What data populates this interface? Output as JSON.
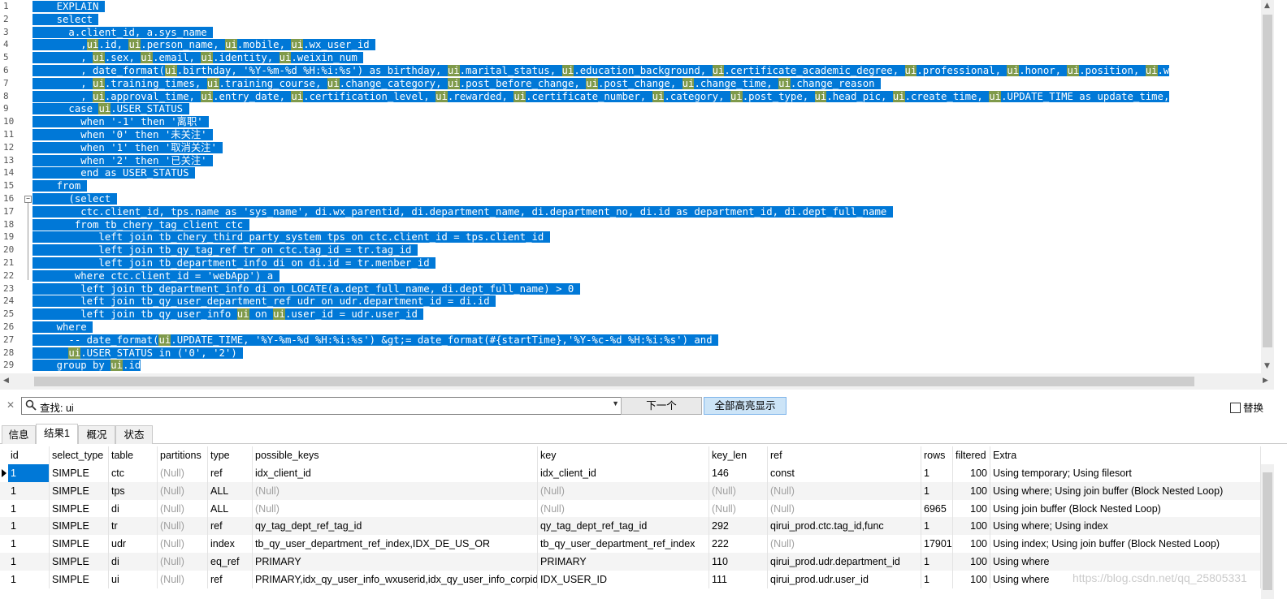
{
  "editor": {
    "line_numbers": [
      "1",
      "2",
      "3",
      "4",
      "5",
      "6",
      "7",
      "8",
      "9",
      "10",
      "11",
      "12",
      "13",
      "14",
      "15",
      "16",
      "17",
      "18",
      "19",
      "20",
      "21",
      "22",
      "23",
      "24",
      "25",
      "26",
      "27",
      "28",
      "29"
    ],
    "lines": [
      [
        [
          "",
          "    EXPLAIN "
        ]
      ],
      [
        [
          "",
          "    select "
        ]
      ],
      [
        [
          "",
          "      a.client_id, a.sys_name "
        ]
      ],
      [
        [
          "",
          "        ,"
        ],
        [
          "h",
          "ui"
        ],
        [
          "",
          ".id, "
        ],
        [
          "h",
          "ui"
        ],
        [
          "",
          ".person_name, "
        ],
        [
          "h",
          "ui"
        ],
        [
          "",
          ".mobile, "
        ],
        [
          "h",
          "ui"
        ],
        [
          "",
          ".wx_user_id "
        ]
      ],
      [
        [
          "",
          "        , "
        ],
        [
          "h",
          "ui"
        ],
        [
          "",
          ".sex, "
        ],
        [
          "h",
          "ui"
        ],
        [
          "",
          ".email, "
        ],
        [
          "h",
          "ui"
        ],
        [
          "",
          ".identity, "
        ],
        [
          "h",
          "ui"
        ],
        [
          "",
          ".weixin_num "
        ]
      ],
      [
        [
          "",
          "        , date_format("
        ],
        [
          "h",
          "ui"
        ],
        [
          "",
          ".birthday, '%Y-%m-%d %H:%i:%s') as birthday, "
        ],
        [
          "h",
          "ui"
        ],
        [
          "",
          ".marital_status, "
        ],
        [
          "h",
          "ui"
        ],
        [
          "",
          ".education_background, "
        ],
        [
          "h",
          "ui"
        ],
        [
          "",
          ".certificate_academic_degree, "
        ],
        [
          "h",
          "ui"
        ],
        [
          "",
          ".professional, "
        ],
        [
          "h",
          "ui"
        ],
        [
          "",
          ".honor, "
        ],
        [
          "h",
          "ui"
        ],
        [
          "",
          ".position, "
        ],
        [
          "h",
          "ui"
        ],
        [
          "",
          ".w"
        ]
      ],
      [
        [
          "",
          "        , "
        ],
        [
          "h",
          "ui"
        ],
        [
          "",
          ".training_times, "
        ],
        [
          "h",
          "ui"
        ],
        [
          "",
          ".training_course, "
        ],
        [
          "h",
          "ui"
        ],
        [
          "",
          ".change_category, "
        ],
        [
          "h",
          "ui"
        ],
        [
          "",
          ".post_before_change, "
        ],
        [
          "h",
          "ui"
        ],
        [
          "",
          ".post_change, "
        ],
        [
          "h",
          "ui"
        ],
        [
          "",
          ".change_time, "
        ],
        [
          "h",
          "ui"
        ],
        [
          "",
          ".change_reason "
        ]
      ],
      [
        [
          "",
          "        , "
        ],
        [
          "h",
          "ui"
        ],
        [
          "",
          ".approval_time, "
        ],
        [
          "h",
          "ui"
        ],
        [
          "",
          ".entry_date, "
        ],
        [
          "h",
          "ui"
        ],
        [
          "",
          ".certification_level, "
        ],
        [
          "h",
          "ui"
        ],
        [
          "",
          ".rewarded, "
        ],
        [
          "h",
          "ui"
        ],
        [
          "",
          ".certificate_number, "
        ],
        [
          "h",
          "ui"
        ],
        [
          "",
          ".category, "
        ],
        [
          "h",
          "ui"
        ],
        [
          "",
          ".post_type, "
        ],
        [
          "h",
          "ui"
        ],
        [
          "",
          ".head_pic, "
        ],
        [
          "h",
          "ui"
        ],
        [
          "",
          ".create_time, "
        ],
        [
          "h",
          "ui"
        ],
        [
          "",
          ".UPDATE_TIME as update_time,"
        ]
      ],
      [
        [
          "",
          "      case "
        ],
        [
          "h",
          "ui"
        ],
        [
          "",
          ".USER_STATUS "
        ]
      ],
      [
        [
          "",
          "        when '-1' then '离职' "
        ]
      ],
      [
        [
          "",
          "        when '0' then '未关注' "
        ]
      ],
      [
        [
          "",
          "        when '1' then '取消关注' "
        ]
      ],
      [
        [
          "",
          "        when '2' then '已关注' "
        ]
      ],
      [
        [
          "",
          "        end as USER_STATUS "
        ]
      ],
      [
        [
          "",
          "    from "
        ]
      ],
      [
        [
          "",
          "      (select "
        ]
      ],
      [
        [
          "",
          "        ctc.client_id, tps.name as 'sys_name', di.wx_parentid, di.department_name, di.department_no, di.id as department_id, di.dept_full_name "
        ]
      ],
      [
        [
          "",
          "       from tb_chery_tag_client ctc "
        ]
      ],
      [
        [
          "",
          "           left join tb_chery_third_party_system tps on ctc.client_id = tps.client_id "
        ]
      ],
      [
        [
          "",
          "           left join tb_qy_tag_ref tr on ctc.tag_id = tr.tag_id "
        ]
      ],
      [
        [
          "",
          "           left join tb_department_info di on di.id = tr.menber_id "
        ]
      ],
      [
        [
          "",
          "       where ctc.client_id = 'webApp') a "
        ]
      ],
      [
        [
          "",
          "        left join tb_department_info di on LOCATE(a.dept_full_name, di.dept_full_name) > 0 "
        ]
      ],
      [
        [
          "",
          "        left join tb_qy_user_department_ref udr on udr.department_id = di.id "
        ]
      ],
      [
        [
          "",
          "        left join tb_qy_user_info "
        ],
        [
          "h",
          "ui"
        ],
        [
          "",
          " on "
        ],
        [
          "h",
          "ui"
        ],
        [
          "",
          ".user_id = udr.user_id "
        ]
      ],
      [
        [
          "",
          "    where "
        ]
      ],
      [
        [
          "",
          "      -- date_format("
        ],
        [
          "h",
          "ui"
        ],
        [
          "",
          ".UPDATE_TIME, '%Y-%m-%d %H:%i:%s') &gt;= date_format(#{startTime},'%Y-%c-%d %H:%i:%s') and "
        ]
      ],
      [
        [
          "",
          "      "
        ],
        [
          "h",
          "ui"
        ],
        [
          "",
          ".USER_STATUS in ('0', '2') "
        ]
      ],
      [
        [
          "",
          "    group by "
        ],
        [
          "h",
          "ui"
        ],
        [
          "",
          ".id"
        ]
      ]
    ]
  },
  "findbar": {
    "label": "查找: ui",
    "next_label": "下一个",
    "highlight_all_label": "全部高亮显示",
    "replace_label": "替换"
  },
  "tabs": [
    "信息",
    "结果1",
    "概况",
    "状态"
  ],
  "active_tab": 1,
  "grid": {
    "columns": [
      "id",
      "select_type",
      "table",
      "partitions",
      "type",
      "possible_keys",
      "key",
      "key_len",
      "ref",
      "rows",
      "filtered",
      "Extra"
    ],
    "rows": [
      [
        "1",
        "SIMPLE",
        "ctc",
        "(Null)",
        "ref",
        "idx_client_id",
        "idx_client_id",
        "146",
        "const",
        "1",
        "100",
        "Using temporary; Using filesort"
      ],
      [
        "1",
        "SIMPLE",
        "tps",
        "(Null)",
        "ALL",
        "(Null)",
        "(Null)",
        "(Null)",
        "(Null)",
        "1",
        "100",
        "Using where; Using join buffer (Block Nested Loop)"
      ],
      [
        "1",
        "SIMPLE",
        "di",
        "(Null)",
        "ALL",
        "(Null)",
        "(Null)",
        "(Null)",
        "(Null)",
        "6965",
        "100",
        "Using join buffer (Block Nested Loop)"
      ],
      [
        "1",
        "SIMPLE",
        "tr",
        "(Null)",
        "ref",
        "qy_tag_dept_ref_tag_id",
        "qy_tag_dept_ref_tag_id",
        "292",
        "qirui_prod.ctc.tag_id,func",
        "1",
        "100",
        "Using where; Using index"
      ],
      [
        "1",
        "SIMPLE",
        "udr",
        "(Null)",
        "index",
        "tb_qy_user_department_ref_index,IDX_DE_US_OR",
        "tb_qy_user_department_ref_index",
        "222",
        "(Null)",
        "17901",
        "100",
        "Using index; Using join buffer (Block Nested Loop)"
      ],
      [
        "1",
        "SIMPLE",
        "di",
        "(Null)",
        "eq_ref",
        "PRIMARY",
        "PRIMARY",
        "110",
        "qirui_prod.udr.department_id",
        "1",
        "100",
        "Using where"
      ],
      [
        "1",
        "SIMPLE",
        "ui",
        "(Null)",
        "ref",
        "PRIMARY,idx_qy_user_info_wxuserid,idx_qy_user_info_corpid,i",
        "IDX_USER_ID",
        "111",
        "qirui_prod.udr.user_id",
        "1",
        "100",
        "Using where"
      ]
    ]
  },
  "watermark": "https://blog.csdn.net/qq_25805331",
  "colors": {
    "selection": "#0078d7",
    "match_highlight": "#7f9a4b"
  }
}
